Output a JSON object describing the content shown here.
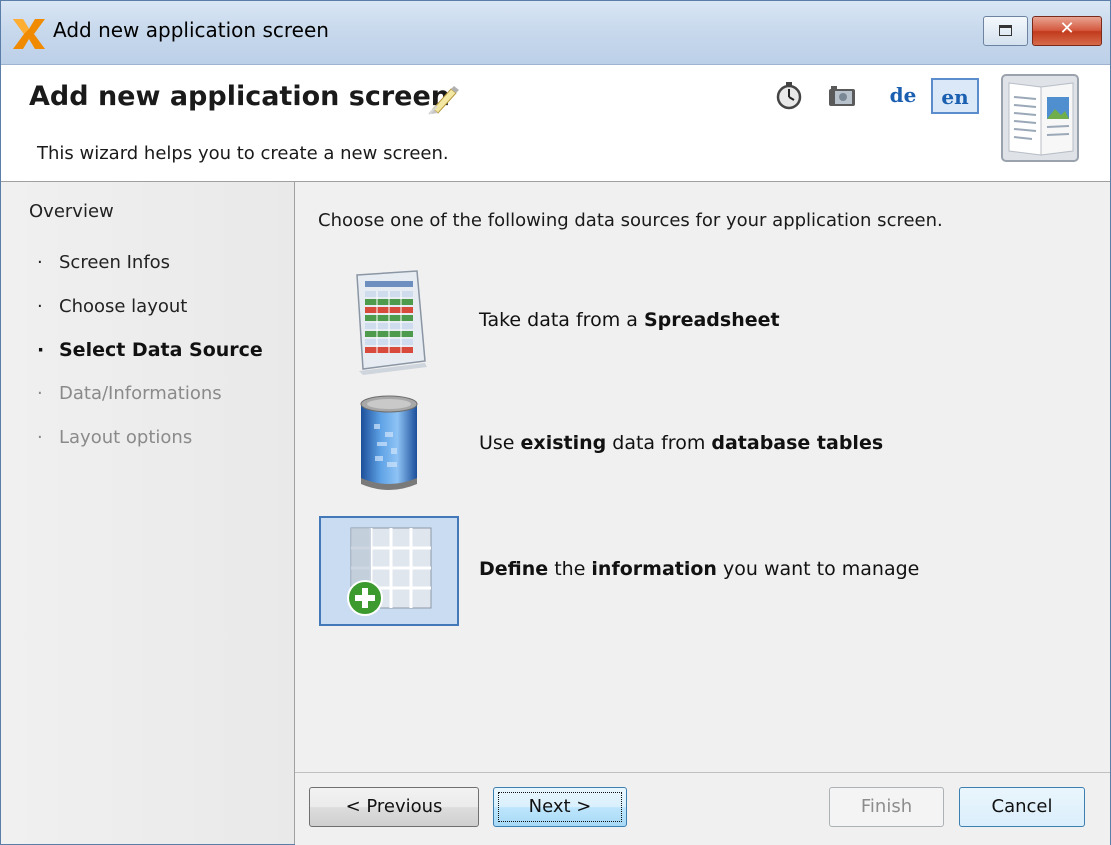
{
  "window": {
    "title": "Add new application screen"
  },
  "header": {
    "title": "Add new application screen",
    "subtitle": "This wizard helps you to create a new screen.",
    "languages": [
      {
        "code": "de",
        "selected": false
      },
      {
        "code": "en",
        "selected": true
      }
    ]
  },
  "sidebar": {
    "heading": "Overview",
    "bullet": "·",
    "steps": [
      {
        "label": "Screen Infos",
        "state": "done"
      },
      {
        "label": "Choose layout",
        "state": "done"
      },
      {
        "label": "Select Data Source",
        "state": "current"
      },
      {
        "label": "Data/Informations",
        "state": "future"
      },
      {
        "label": "Layout options",
        "state": "future"
      }
    ]
  },
  "main": {
    "intro": "Choose one of the following data sources for your application screen.",
    "options": [
      {
        "id": "spreadsheet",
        "icon": "spreadsheet-icon",
        "parts": [
          "Take data from a ",
          "Spreadsheet"
        ],
        "selected": false
      },
      {
        "id": "database",
        "icon": "database-icon",
        "parts": [
          "Use ",
          "existing",
          " data from ",
          "database tables"
        ],
        "selected": false
      },
      {
        "id": "define",
        "icon": "add-table-icon",
        "parts": [
          "Define",
          " the ",
          "information",
          " you want to manage"
        ],
        "selected": true
      }
    ]
  },
  "buttons": {
    "previous": "< Previous",
    "next": "Next >",
    "finish": "Finish",
    "cancel": "Cancel"
  },
  "colors": {
    "accent": "#1a5fb0",
    "selection_bg": "#c9dcf2",
    "selection_border": "#4379b8"
  }
}
